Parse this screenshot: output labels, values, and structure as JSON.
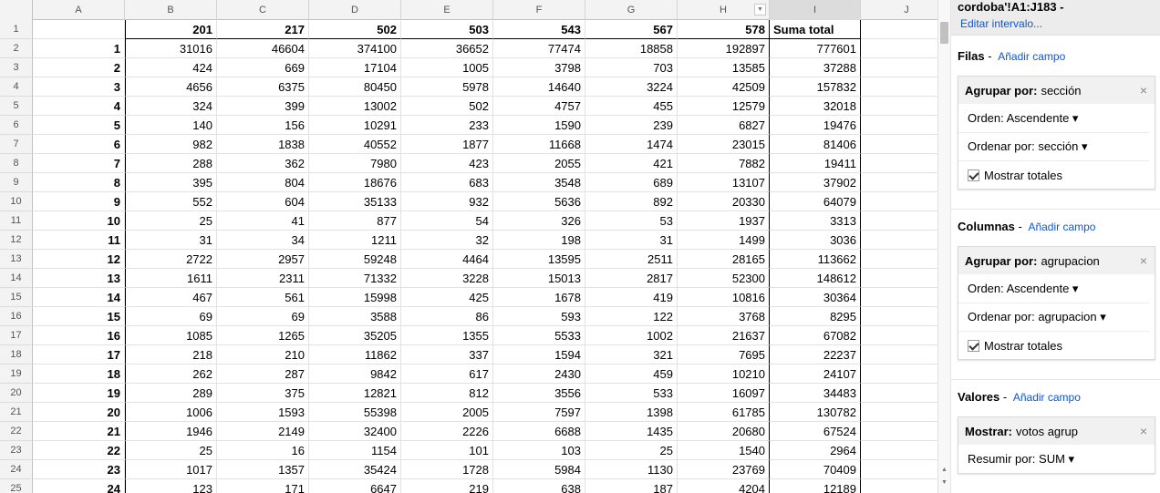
{
  "sheet": {
    "columns": [
      "A",
      "B",
      "C",
      "D",
      "E",
      "F",
      "G",
      "H",
      "I",
      "J"
    ],
    "header_row": [
      "",
      "201",
      "217",
      "502",
      "503",
      "543",
      "567",
      "578",
      "Suma total",
      ""
    ],
    "row_numbers": [
      "1",
      "2",
      "3",
      "4",
      "5",
      "6",
      "7",
      "8",
      "9",
      "10",
      "11",
      "12",
      "13",
      "14",
      "15",
      "16",
      "17",
      "18",
      "19",
      "20",
      "21",
      "22",
      "23",
      "24",
      "25"
    ],
    "data_rows": [
      [
        "1",
        "31016",
        "46604",
        "374100",
        "36652",
        "77474",
        "18858",
        "192897",
        "777601"
      ],
      [
        "2",
        "424",
        "669",
        "17104",
        "1005",
        "3798",
        "703",
        "13585",
        "37288"
      ],
      [
        "3",
        "4656",
        "6375",
        "80450",
        "5978",
        "14640",
        "3224",
        "42509",
        "157832"
      ],
      [
        "4",
        "324",
        "399",
        "13002",
        "502",
        "4757",
        "455",
        "12579",
        "32018"
      ],
      [
        "5",
        "140",
        "156",
        "10291",
        "233",
        "1590",
        "239",
        "6827",
        "19476"
      ],
      [
        "6",
        "982",
        "1838",
        "40552",
        "1877",
        "11668",
        "1474",
        "23015",
        "81406"
      ],
      [
        "7",
        "288",
        "362",
        "7980",
        "423",
        "2055",
        "421",
        "7882",
        "19411"
      ],
      [
        "8",
        "395",
        "804",
        "18676",
        "683",
        "3548",
        "689",
        "13107",
        "37902"
      ],
      [
        "9",
        "552",
        "604",
        "35133",
        "932",
        "5636",
        "892",
        "20330",
        "64079"
      ],
      [
        "10",
        "25",
        "41",
        "877",
        "54",
        "326",
        "53",
        "1937",
        "3313"
      ],
      [
        "11",
        "31",
        "34",
        "1211",
        "32",
        "198",
        "31",
        "1499",
        "3036"
      ],
      [
        "12",
        "2722",
        "2957",
        "59248",
        "4464",
        "13595",
        "2511",
        "28165",
        "113662"
      ],
      [
        "13",
        "1611",
        "2311",
        "71332",
        "3228",
        "15013",
        "2817",
        "52300",
        "148612"
      ],
      [
        "14",
        "467",
        "561",
        "15998",
        "425",
        "1678",
        "419",
        "10816",
        "30364"
      ],
      [
        "15",
        "69",
        "69",
        "3588",
        "86",
        "593",
        "122",
        "3768",
        "8295"
      ],
      [
        "16",
        "1085",
        "1265",
        "35205",
        "1355",
        "5533",
        "1002",
        "21637",
        "67082"
      ],
      [
        "17",
        "218",
        "210",
        "11862",
        "337",
        "1594",
        "321",
        "7695",
        "22237"
      ],
      [
        "18",
        "262",
        "287",
        "9842",
        "617",
        "2430",
        "459",
        "10210",
        "24107"
      ],
      [
        "19",
        "289",
        "375",
        "12821",
        "812",
        "3556",
        "533",
        "16097",
        "34483"
      ],
      [
        "20",
        "1006",
        "1593",
        "55398",
        "2005",
        "7597",
        "1398",
        "61785",
        "130782"
      ],
      [
        "21",
        "1946",
        "2149",
        "32400",
        "2226",
        "6688",
        "1435",
        "20680",
        "67524"
      ],
      [
        "22",
        "25",
        "16",
        "1154",
        "101",
        "103",
        "25",
        "1540",
        "2964"
      ],
      [
        "23",
        "1017",
        "1357",
        "35424",
        "1728",
        "5984",
        "1130",
        "23769",
        "70409"
      ],
      [
        "24",
        "123",
        "171",
        "6647",
        "219",
        "638",
        "187",
        "4204",
        "12189"
      ]
    ]
  },
  "panel": {
    "range": "cordoba'!A1:J183 -",
    "edit_range": "Editar intervalo...",
    "rows_section": {
      "title": "Filas",
      "add": "Añadir campo",
      "group_label": "Agrupar por:",
      "group_value": "sección",
      "order": "Orden: Ascendente ▾",
      "sort_by": "Ordenar por: sección ▾",
      "totals": "Mostrar totales"
    },
    "columns_section": {
      "title": "Columnas",
      "add": "Añadir campo",
      "group_label": "Agrupar por:",
      "group_value": "agrupacion",
      "order": "Orden: Ascendente ▾",
      "sort_by": "Ordenar por: agrupacion ▾",
      "totals": "Mostrar totales"
    },
    "values_section": {
      "title": "Valores",
      "add": "Añadir campo",
      "show_label": "Mostrar:",
      "show_value": "votos agrup",
      "summarize": "Resumir por: SUM ▾"
    },
    "close_glyph": "×",
    "dash": "-"
  }
}
